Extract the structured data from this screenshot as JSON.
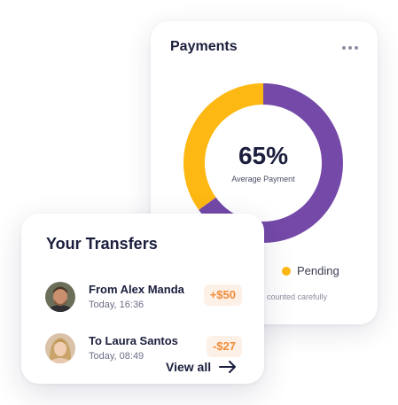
{
  "payments": {
    "title": "Payments",
    "menu_icon": "more-horizontal-icon",
    "footnote": "counted carefully",
    "legend": {
      "label": "Pending",
      "color": "#fdb813"
    }
  },
  "chart_data": {
    "type": "pie",
    "center_value": "65%",
    "center_label": "Average Payment",
    "slices": [
      {
        "label": "",
        "value": 65,
        "color": "#7449a8"
      },
      {
        "label": "Pending",
        "value": 35,
        "color": "#fdb813"
      }
    ]
  },
  "transfers": {
    "title": "Your Transfers",
    "items": [
      {
        "name": "From Alex Manda",
        "time": "Today, 16:36",
        "amount": "+$50",
        "avatar": "man-avatar"
      },
      {
        "name": "To Laura Santos",
        "time": "Today, 08:49",
        "amount": "-$27",
        "avatar": "woman-avatar"
      }
    ],
    "view_all": "View all",
    "view_all_icon": "arrow-right-icon"
  },
  "colors": {
    "accent_purple": "#7449a8",
    "accent_yellow": "#fdb813",
    "amount_text": "#f28c38",
    "amount_bg": "#fdf0e6",
    "text_dark": "#1b1e3d"
  }
}
